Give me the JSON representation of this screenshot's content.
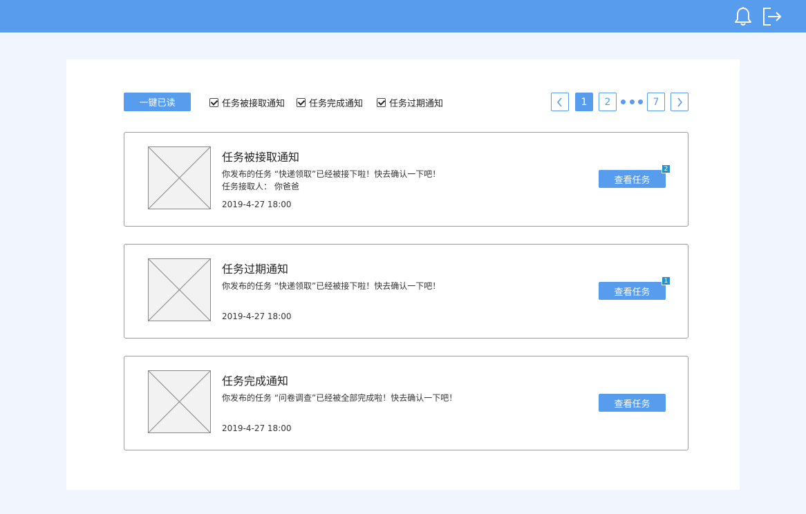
{
  "header": {
    "bell_icon": "bell-icon",
    "logout_icon": "logout-icon",
    "bg_color": "#589ced"
  },
  "toolbar": {
    "mark_all_read_label": "一键已读",
    "filters": [
      {
        "label": "任务被接取通知",
        "checked": true
      },
      {
        "label": "任务完成通知",
        "checked": true
      },
      {
        "label": "任务过期通知",
        "checked": true
      }
    ]
  },
  "pagination": {
    "prev_icon": "chevron-left-icon",
    "next_icon": "chevron-right-icon",
    "pages": [
      "1",
      "2",
      "7"
    ],
    "current": "1"
  },
  "notices": [
    {
      "title": "任务被接取通知",
      "message": "你发布的任务 “快递领取”已经被接下啦！快去确认一下吧！",
      "extra": "任务接取人： 你爸爸",
      "time": "2019-4-27 18:00",
      "button_label": "查看任务",
      "badge": "2"
    },
    {
      "title": "任务过期通知",
      "message": "你发布的任务 “快递领取”已经被接下啦！快去确认一下吧！",
      "extra": "",
      "time": "2019-4-27 18:00",
      "button_label": "查看任务",
      "badge": "1"
    },
    {
      "title": "任务完成通知",
      "message": "你发布的任务 “问卷调查”已经被全部完成啦！快去确认一下吧！",
      "extra": "",
      "time": "2019-4-27 18:00",
      "button_label": "查看任务",
      "badge": ""
    }
  ]
}
